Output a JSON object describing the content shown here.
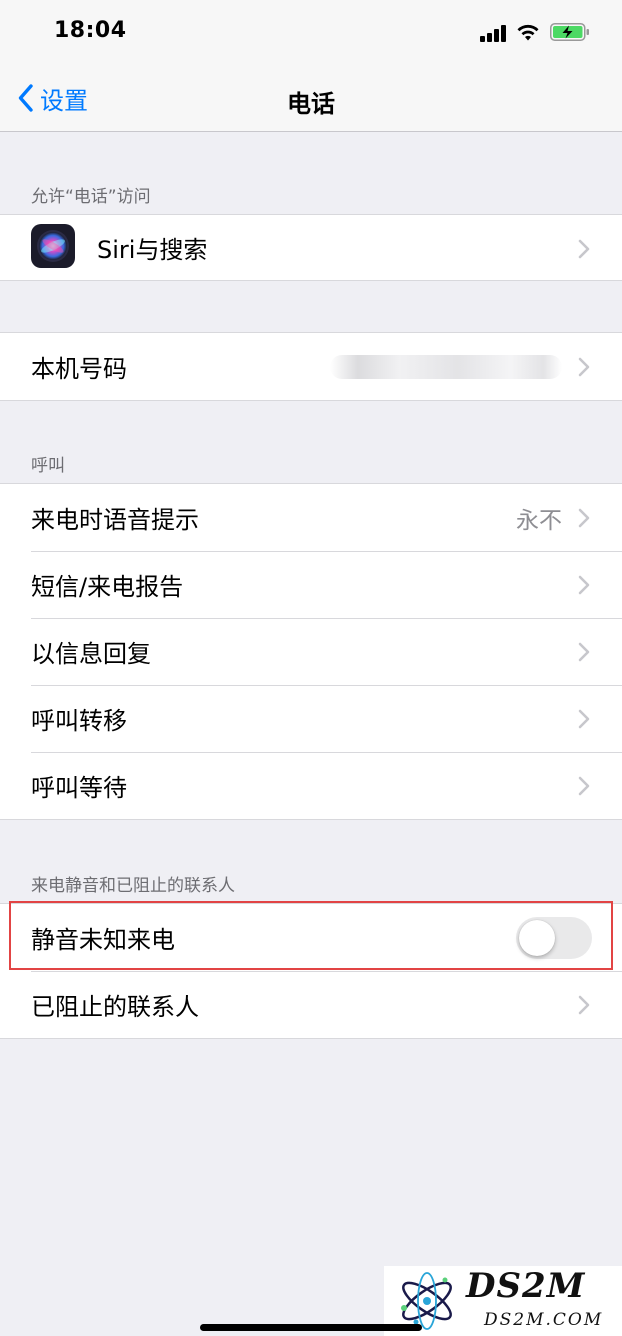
{
  "status_bar": {
    "time": "18:04"
  },
  "nav": {
    "back_label": "设置",
    "title": "电话"
  },
  "sections": {
    "allow_access_header": "允许“电话”访问",
    "calls_header": "呼叫",
    "silence_header": "来电静音和已阻止的联系人"
  },
  "rows": {
    "siri": {
      "label": "Siri与搜索"
    },
    "my_number": {
      "label": "本机号码"
    },
    "announce_calls": {
      "label": "来电时语音提示",
      "value": "永不"
    },
    "sms_call_reporting": {
      "label": "短信/来电报告"
    },
    "respond_with_text": {
      "label": "以信息回复"
    },
    "call_forwarding": {
      "label": "呼叫转移"
    },
    "call_waiting": {
      "label": "呼叫等待"
    },
    "silence_unknown": {
      "label": "静音未知来电",
      "enabled": false
    },
    "blocked_contacts": {
      "label": "已阻止的联系人"
    }
  },
  "watermark": {
    "brand": "DS2M",
    "site": "DS2M.COM"
  },
  "colors": {
    "accent": "#007aff",
    "highlight": "#e24444",
    "background": "#efeff4"
  }
}
